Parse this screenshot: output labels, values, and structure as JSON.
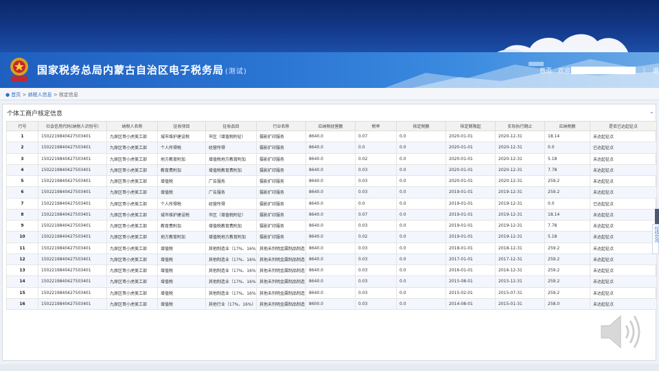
{
  "header": {
    "title": "国家税务总局内蒙古自治区电子税务局",
    "env": "(测试)",
    "home_link": "首页",
    "welcome": "欢迎",
    "logout": "退出",
    "separator": "|"
  },
  "breadcrumb": {
    "home": "首页",
    "sep": ">",
    "level1": "纳税人信息",
    "level2": "核定信息"
  },
  "panel": {
    "title": "个体工商户核定信息"
  },
  "table": {
    "headers": [
      "行号",
      "社会信用代码(纳税人识别号)",
      "纳税人名称",
      "征收项目",
      "征收品目",
      "行业名称",
      "应纳税经营额",
      "税率",
      "核定税额",
      "核定期限起",
      "实际执行期止",
      "应纳税额",
      "是否已达起征点"
    ],
    "rows": [
      [
        "1",
        "150221984042750340​1",
        "九原区哥小虎美工部",
        "城市维护建设税",
        "市区（增值税附征）",
        "摄影扩印服务",
        "8640.0",
        "0.07",
        "0.0",
        "2020-01-01",
        "2020-12-31",
        "18.14",
        "未达起征点"
      ],
      [
        "2",
        "150221984042750340​1",
        "九原区哥小虎美工部",
        "个人所得税",
        "经营所得",
        "摄影扩印服务",
        "8640.0",
        "0.0",
        "0.0",
        "2020-01-01",
        "2020-12-31",
        "0.0",
        "已达起征点"
      ],
      [
        "3",
        "150221984042750340​1",
        "九原区哥小虎美工部",
        "地方教育附加",
        "增值税地方教育附加",
        "摄影扩印服务",
        "8640.0",
        "0.02",
        "0.0",
        "2020-01-01",
        "2020-12-31",
        "5.18",
        "未达起征点"
      ],
      [
        "4",
        "150221984042750340​1",
        "九原区哥小虎美工部",
        "教育费附加",
        "增值税教育费附加",
        "摄影扩印服务",
        "8640.0",
        "0.03",
        "0.0",
        "2020-01-01",
        "2020-12-31",
        "7.78",
        "未达起征点"
      ],
      [
        "5",
        "150221984042750340​1",
        "九原区哥小虎美工部",
        "增值税",
        "广告服务",
        "摄影扩印服务",
        "8640.0",
        "0.03",
        "0.0",
        "2020-01-01",
        "2020-12-31",
        "259.2",
        "未达起征点"
      ],
      [
        "6",
        "150221984042750340​1",
        "九原区哥小虎美工部",
        "增值税",
        "广告服务",
        "摄影扩印服务",
        "8640.0",
        "0.03",
        "0.0",
        "2019-01-01",
        "2019-12-31",
        "259.2",
        "未达起征点"
      ],
      [
        "7",
        "150221984042750340​1",
        "九原区哥小虎美工部",
        "个人所得税",
        "经营所得",
        "摄影扩印服务",
        "8640.0",
        "0.0",
        "0.0",
        "2019-01-01",
        "2019-12-31",
        "0.0",
        "已达起征点"
      ],
      [
        "8",
        "150221984042750340​1",
        "九原区哥小虎美工部",
        "城市维护建设税",
        "市区（增值税附征）",
        "摄影扩印服务",
        "8640.0",
        "0.07",
        "0.0",
        "2019-01-01",
        "2019-12-31",
        "18.14",
        "未达起征点"
      ],
      [
        "9",
        "150221984042750340​1",
        "九原区哥小虎美工部",
        "教育费附加",
        "增值税教育费附加",
        "摄影扩印服务",
        "8640.0",
        "0.03",
        "0.0",
        "2019-01-01",
        "2019-12-31",
        "7.78",
        "未达起征点"
      ],
      [
        "10",
        "150221984042750340​1",
        "九原区哥小虎美工部",
        "地方教育附加",
        "增值税地方教育附加",
        "摄影扩印服务",
        "8640.0",
        "0.02",
        "0.0",
        "2019-01-01",
        "2019-12-31",
        "5.18",
        "未达起征点"
      ],
      [
        "11",
        "150221984042750340​1",
        "九原区哥小虎美工部",
        "增值税",
        "其他制造业（17%、16%…",
        "其他未列明金属制品制造",
        "8640.0",
        "0.03",
        "0.0",
        "2018-01-01",
        "2018-12-31",
        "259.2",
        "未达起征点"
      ],
      [
        "12",
        "150221984042750340​1",
        "九原区哥小虎美工部",
        "增值税",
        "其他制造业（17%、16%…",
        "其他未列明金属制品制造",
        "8640.0",
        "0.03",
        "0.0",
        "2017-01-01",
        "2017-12-31",
        "259.2",
        "未达起征点"
      ],
      [
        "13",
        "150221984042750340​1",
        "九原区哥小虎美工部",
        "增值税",
        "其他制造业（17%、16%…",
        "其他未列明金属制品制造",
        "8640.0",
        "0.03",
        "0.0",
        "2016-01-01",
        "2016-12-31",
        "259.2",
        "未达起征点"
      ],
      [
        "14",
        "150221984042750340​1",
        "九原区哥小虎美工部",
        "增值税",
        "其他制造业（17%、16%…",
        "其他未列明金属制品制造",
        "8640.0",
        "0.03",
        "0.0",
        "2015-08-01",
        "2015-12-31",
        "259.2",
        "未达起征点"
      ],
      [
        "15",
        "150221984042750340​1",
        "九原区哥小虎美工部",
        "增值税",
        "其他制造业（17%、16%…",
        "其他未列明金属制品制造",
        "8640.0",
        "0.03",
        "0.0",
        "2015-02-01",
        "2015-07-31",
        "259.2",
        "未达起征点"
      ],
      [
        "16",
        "150221984042750340​1",
        "九原区哥小虎美工部",
        "增值税",
        "其他行业（17%、16%）",
        "其他未列明金属制品制造",
        "8600.0",
        "0.03",
        "0.0",
        "2014-08-01",
        "2015-01-31",
        "258.0",
        "未达起征点"
      ]
    ]
  },
  "side_tab": {
    "label": "在线交流"
  },
  "icons": {
    "location": "location-pin-icon",
    "collapse": "chevron-down-icon",
    "speaker": "speaker-icon",
    "emblem": "tax-emblem-icon"
  },
  "colors": {
    "header_dark": "#0b2769",
    "banner": "#2a74d2",
    "link": "#2f6cc4",
    "row_alt": "#f3f7fd"
  }
}
